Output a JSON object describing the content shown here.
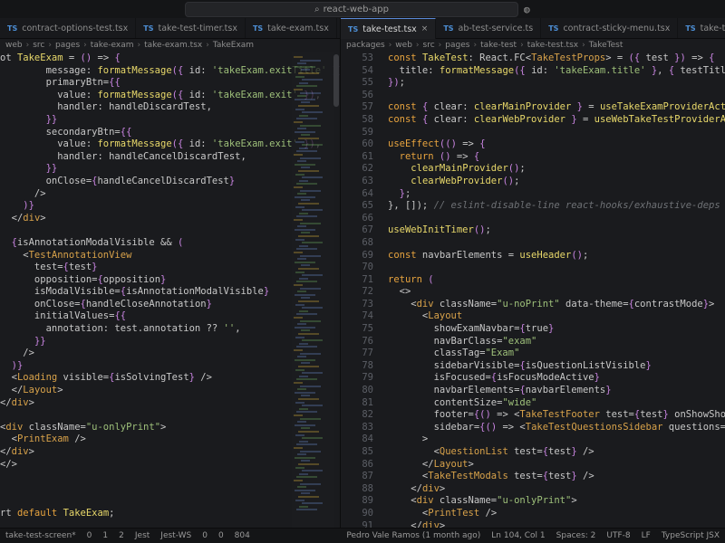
{
  "window": {
    "search_label": "react-web-app"
  },
  "left_group": {
    "tabs": [
      {
        "icon": "TS",
        "label": "contract-options-test.tsx",
        "icon_color": "#4d8fd6"
      },
      {
        "icon": "TS",
        "label": "take-test-timer.tsx",
        "icon_color": "#4d8fd6"
      },
      {
        "icon": "TS",
        "label": "take-exam.tsx",
        "icon_color": "#4d8fd6"
      }
    ],
    "breadcrumbs": [
      "web",
      "src",
      "pages",
      "take-exam",
      "take-exam.tsx",
      "TakeExam"
    ],
    "code": [
      "ot TakeExam = () => {",
      "        message: formatMessage({ id: 'takeExam.exitTitle' }),",
      "        primaryBtn={{",
      "          value: formatMessage({ id: 'takeExam.exit' }),",
      "          handler: handleDiscardTest,",
      "        }}",
      "        secondaryBtn={{",
      "          value: formatMessage({ id: 'takeExam.exit' }),",
      "          handler: handleCancelDiscardTest,",
      "        }}",
      "        onClose={handleCancelDiscardTest}",
      "      />",
      "    )}",
      "  </div>",
      "",
      "  {isAnnotationModalVisible && (",
      "    <TestAnnotationView",
      "      test={test}",
      "      opposition={opposition}",
      "      isModalVisible={isAnnotationModalVisible}",
      "      onClose={handleCloseAnnotation}",
      "      initialValues={{",
      "        annotation: test.annotation ?? '',",
      "      }}",
      "    />",
      "  )}",
      "  <Loading visible={isSolvingTest} />",
      "  </Layout>",
      "</div>",
      "",
      "<div className=\"u-onlyPrint\">",
      "  <PrintExam />",
      "</div>",
      "</>",
      "",
      "",
      "",
      "rt default TakeExam;"
    ]
  },
  "right_group": {
    "tabs": [
      {
        "icon": "TS",
        "label": "take-test.tsx",
        "icon_color": "#4d8fd6",
        "active": true
      },
      {
        "icon": "TS",
        "label": "ab-test-service.ts",
        "icon_color": "#4d8fd6"
      },
      {
        "icon": "TS",
        "label": "contract-sticky-menu.tsx",
        "icon_color": "#4d8fd6"
      },
      {
        "icon": "TS",
        "label": "take-test-timer.tsx",
        "icon_color": "#4d8fd6"
      }
    ],
    "breadcrumbs": [
      "packages",
      "web",
      "src",
      "pages",
      "take-test",
      "take-test.tsx",
      "TakeTest"
    ],
    "line_numbers": [
      "53",
      "54",
      "55",
      "56",
      "57",
      "58",
      "59",
      "60",
      "61",
      "62",
      "63",
      "64",
      "65",
      "66",
      "67",
      "68",
      "69",
      "70",
      "71",
      "72",
      "73",
      "74",
      "75",
      "76",
      "77",
      "78",
      "79",
      "80",
      "81",
      "82",
      "83",
      "84",
      "85",
      "86",
      "87",
      "88",
      "89",
      "90",
      "91",
      "92"
    ],
    "code": [
      "const TakeTest: React.FC<TakeTestProps> = ({ test }) => {",
      "  title: formatMessage({ id: 'takeExam.title' }, { testTitle",
      "});",
      "",
      "const { clear: clearMainProvider } = useTakeExamProviderActions();",
      "const { clear: clearWebProvider } = useWebTakeTestProviderActions();",
      "",
      "useEffect(() => {",
      "  return () => {",
      "    clearMainProvider();",
      "    clearWebProvider();",
      "  };",
      "}, []); // eslint-disable-line react-hooks/exhaustive-deps",
      "",
      "useWebInitTimer();",
      "",
      "const navbarElements = useHeader();",
      "",
      "return (",
      "  <>",
      "    <div className=\"u-noPrint\" data-theme={contrastMode}>",
      "      <Layout",
      "        showExamNavbar={true}",
      "        navBarClass=\"exam\"",
      "        classTag=\"Exam\"",
      "        sidebarVisible={isQuestionListVisible}",
      "        isFocused={isFocusModeActive}",
      "        navbarElements={navbarElements}",
      "        contentSize=\"wide\"",
      "        footer={() => <TakeTestFooter test={test} onShowShortcuts={",
      "        sidebar={() => <TakeTestQuestionsSidebar questions={test.qu",
      "      >",
      "        <QuestionList test={test} />",
      "      </Layout>",
      "      <TakeTestModals test={test} />",
      "    </div>",
      "    <div className=\"u-onlyPrint\">",
      "      <PrintTest />",
      "    </div>",
      "  </>"
    ]
  },
  "statusbar": {
    "items": [
      "take-test-screen*",
      "0",
      "1",
      "2",
      "Jest",
      "Jest-WS",
      "0",
      "0",
      "804"
    ],
    "right_items": [
      "Pedro Vale Ramos (1 month ago)",
      "Ln 104, Col 1",
      "Spaces: 2",
      "UTF-8",
      "LF",
      "TypeScript JSX"
    ]
  },
  "theme": {
    "accent": "#5a8ad8",
    "keyword": "#e7a33e",
    "function": "#e8d86a",
    "string": "#9ec07a"
  }
}
